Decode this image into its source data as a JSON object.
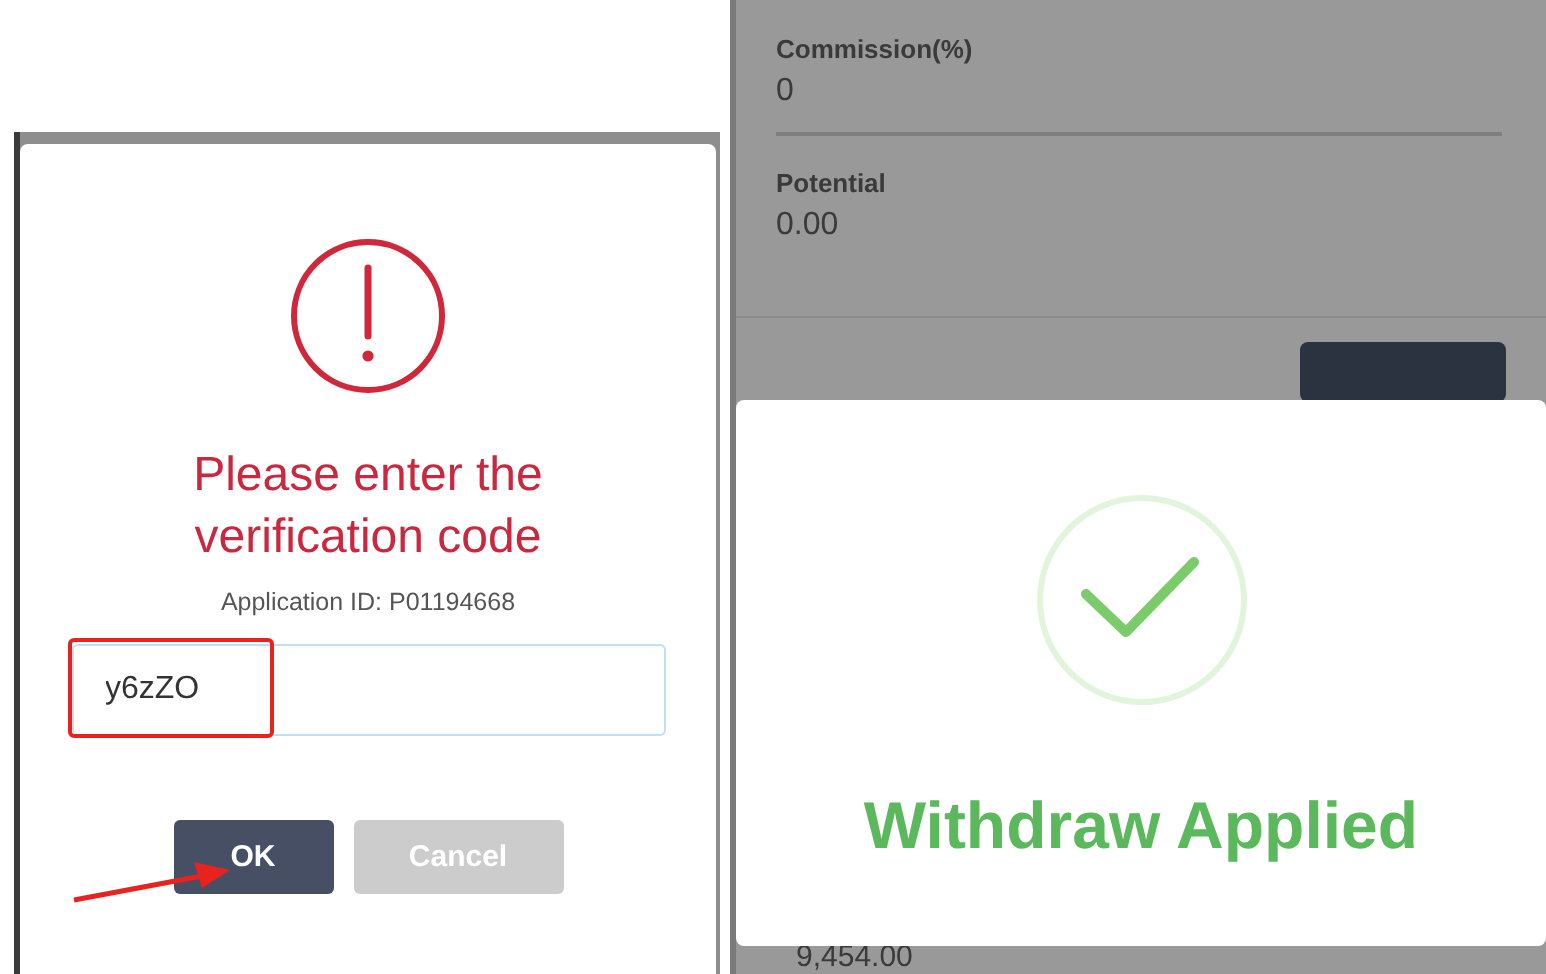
{
  "verification_dialog": {
    "title": "Please enter the verification code",
    "application_id": "Application ID: P01194668",
    "code_field": {
      "value": "y6zZO"
    },
    "buttons": [
      {
        "label": "OK",
        "kind": "primary"
      },
      {
        "label": "Cancel",
        "kind": "secondary"
      }
    ]
  },
  "background_page": {
    "fields": [
      {
        "label": "Commission(%)",
        "value": "0"
      },
      {
        "label": "Potential",
        "value": "0.00"
      }
    ],
    "amount": "9,454.00"
  },
  "success_dialog": {
    "message": "Withdraw Applied"
  }
}
